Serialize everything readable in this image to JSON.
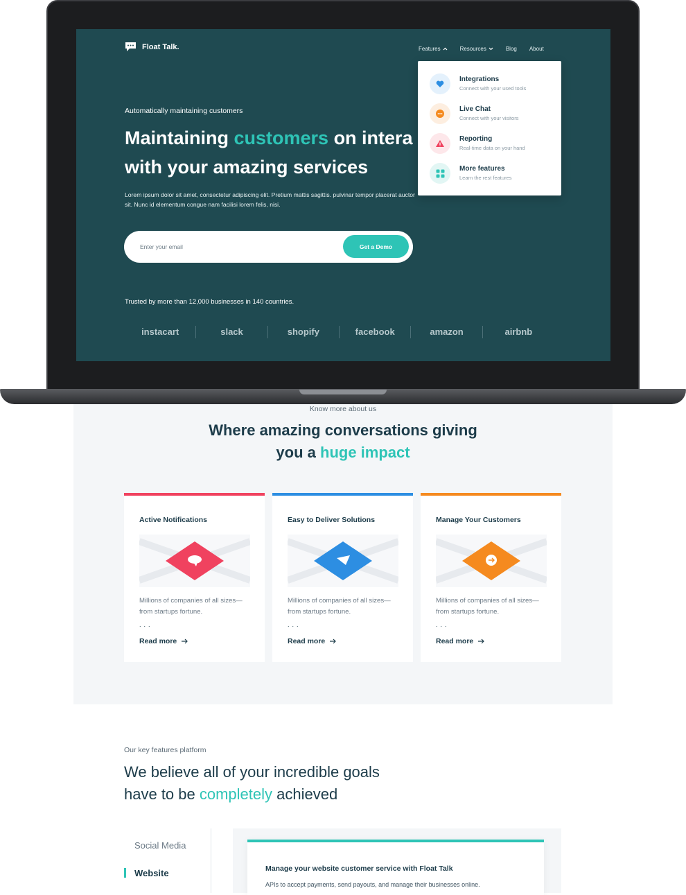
{
  "hero": {
    "brand_name": "Float Talk.",
    "nav": [
      {
        "label": "Features"
      },
      {
        "label": "Resources"
      },
      {
        "label": "Blog"
      },
      {
        "label": "About"
      }
    ],
    "dropdown": [
      {
        "title": "Integrations",
        "subtitle": "Connect with your used tools",
        "icon": "heart-icon",
        "color": "#2d8ee2",
        "bg": "#e4f1fc"
      },
      {
        "title": "Live Chat",
        "subtitle": "Connect with your visitors",
        "icon": "chat-icon",
        "color": "#f58a1f",
        "bg": "#fdeee0"
      },
      {
        "title": "Reporting",
        "subtitle": "Real-time data on your hand",
        "icon": "warning-icon",
        "color": "#f0425f",
        "bg": "#fde7ea"
      },
      {
        "title": "More features",
        "subtitle": "Learn the rest features",
        "icon": "grid-icon",
        "color": "#2ec4b6",
        "bg": "#e2f6f4"
      }
    ],
    "kicker": "Automatically maintaining customers",
    "title_part1": "Maintaining ",
    "title_accent": "customers",
    "title_part2": " on intera",
    "title_line2": "with your amazing services",
    "description": "Lorem ipsum dolor sit amet, consectetur adipiscing elit. Pretium mattis sagittis. pulvinar tempor placerat auctor sit. Nunc id elementum congue nam facilisi lorem felis, nisi.",
    "email_placeholder": "Enter your email",
    "cta_label": "Get a Demo",
    "trusted": "Trusted by more than 12,000 businesses in 140 countries.",
    "brands": [
      "instacart",
      "slack",
      "shopify",
      "facebook",
      "amazon",
      "airbnb"
    ]
  },
  "impact": {
    "kicker": "Know more about us",
    "title_line1": "Where amazing conversations giving",
    "title_line2_a": "you a ",
    "title_line2_accent": "huge impact",
    "cards": [
      {
        "title": "Active Notifications",
        "text": "Millions of companies of all sizes—from startups fortune.",
        "dots": "...",
        "link": "Read more",
        "color": "#f0425f"
      },
      {
        "title": "Easy to Deliver Solutions",
        "text": "Millions of companies of all sizes—from startups fortune.",
        "dots": "...",
        "link": "Read more",
        "color": "#2d8ee2"
      },
      {
        "title": "Manage Your Customers",
        "text": "Millions of companies of all sizes—from startups fortune.",
        "dots": "...",
        "link": "Read more",
        "color": "#f58a1f"
      }
    ]
  },
  "features": {
    "kicker": "Our key features platform",
    "title_line1": "We believe all of your incredible goals",
    "title_line2_a": "have to be ",
    "title_line2_accent": "completely",
    "title_line2_b": " achieved",
    "tabs": [
      {
        "label": "Social Media",
        "active": false
      },
      {
        "label": "Website",
        "active": true
      }
    ],
    "panel_title": "Manage your website customer service with Float Talk",
    "panel_text": "APIs to accept payments, send payouts, and manage their businesses online."
  }
}
